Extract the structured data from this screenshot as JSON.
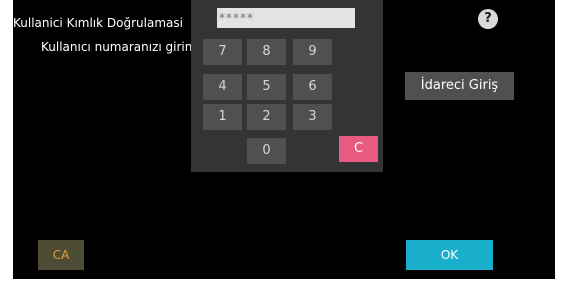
{
  "auth": {
    "title": "Kullanici Kımlık Doğrulamasi",
    "prompt": "Kullanıcı numaranızı girin.",
    "pin_value": "*****"
  },
  "keypad": {
    "keys": [
      "7",
      "8",
      "9",
      "4",
      "5",
      "6",
      "1",
      "2",
      "3",
      "0"
    ],
    "clear_label": "C"
  },
  "help_label": "?",
  "admin_login_label": "İdareci Giriş",
  "ca_label": "CA",
  "ok_label": "OK",
  "colors": {
    "background": "#000000",
    "keypad_panel": "#343434",
    "key": "#505050",
    "clear_key": "#e85a80",
    "ok_button": "#19aecb",
    "ca_text": "#d8a23a"
  }
}
